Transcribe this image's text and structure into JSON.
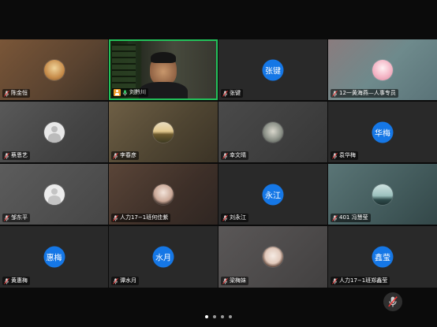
{
  "participants": [
    {
      "name": "陈金恒",
      "type": "avatar",
      "bg": "#6a4e35",
      "avatar_bg": "#c9a46a"
    },
    {
      "name": "刘黔川",
      "type": "video",
      "bg": "#1e2418",
      "active_speaker": true
    },
    {
      "name": "张键",
      "type": "initial",
      "initial": "张键",
      "bg": "#292929"
    },
    {
      "name": "12一黄海燕—人事专员",
      "type": "avatar",
      "bg": "#6e8c8c",
      "avatar_bg": "#f2b8c4"
    },
    {
      "name": "蔡恩艺",
      "type": "avatar",
      "bg": "#4a4a4a",
      "avatar_bg": "#e4e4e4"
    },
    {
      "name": "李春彦",
      "type": "avatar",
      "bg": "#5a4d38",
      "avatar_bg": "#d8c08a"
    },
    {
      "name": "幸文晴",
      "type": "avatar",
      "bg": "#3a3a3a",
      "avatar_bg": "#b9bdb8"
    },
    {
      "name": "袁华梅",
      "type": "initial",
      "initial": "华梅",
      "bg": "#292929"
    },
    {
      "name": "邹东平",
      "type": "avatar",
      "bg": "#4b4b4b",
      "avatar_bg": "#e6e6e6"
    },
    {
      "name": "人力17−1班何佳紫",
      "type": "avatar",
      "bg": "#4d3a30",
      "avatar_bg": "#d9c2b5"
    },
    {
      "name": "刘永江",
      "type": "initial",
      "initial": "永江",
      "bg": "#292929"
    },
    {
      "name": "401 冯慧莹",
      "type": "avatar",
      "bg": "#4a6364",
      "avatar_bg": "#a8c6c4"
    },
    {
      "name": "黄惠梅",
      "type": "initial",
      "initial": "惠梅",
      "bg": "#292929"
    },
    {
      "name": "谭水月",
      "type": "initial",
      "initial": "水月",
      "bg": "#292929"
    },
    {
      "name": "梁梅妹",
      "type": "avatar",
      "bg": "#4a4848",
      "avatar_bg": "#e0d2c8"
    },
    {
      "name": "人力17−1班郑鑫莹",
      "type": "initial",
      "initial": "鑫莹",
      "bg": "#292929"
    }
  ],
  "controls": {
    "mute_icon": "microphone-muted-icon"
  },
  "pagination": {
    "pages": 4,
    "active": 0
  },
  "colors": {
    "accent": "#1577e6",
    "active_border": "#23c15a"
  }
}
